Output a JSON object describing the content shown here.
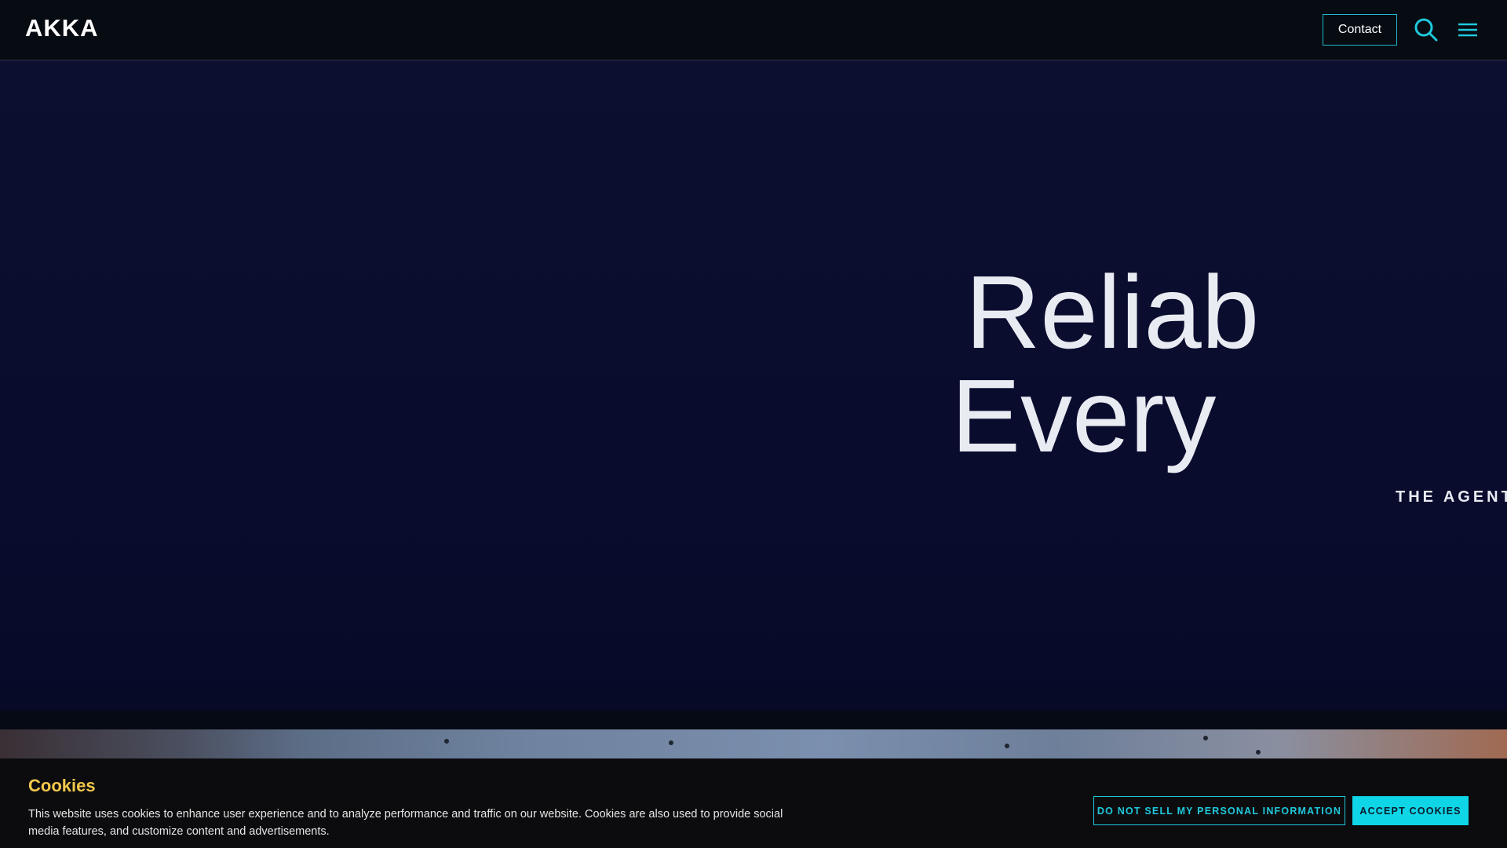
{
  "header": {
    "logo_text": "AKKA",
    "contact_label": "Contact",
    "search_icon": "search-icon",
    "menu_icon": "hamburger-menu-icon"
  },
  "hero": {
    "title_line1": "Reliab",
    "title_line2": "Every",
    "subtitle": "THE AGENT"
  },
  "cookie_banner": {
    "title": "Cookies",
    "text": "This website uses cookies to enhance user experience and to analyze performance and traffic on our website. Cookies are also used to provide social media features, and customize content and advertisements.",
    "do_not_sell_label": "DO NOT SELL MY PERSONAL INFORMATION",
    "accept_label": "ACCEPT COOKIES"
  },
  "colors": {
    "accent": "#1fc9dc",
    "cookie_title": "#f2c84b",
    "hero_bg": "#0a0c2e"
  }
}
